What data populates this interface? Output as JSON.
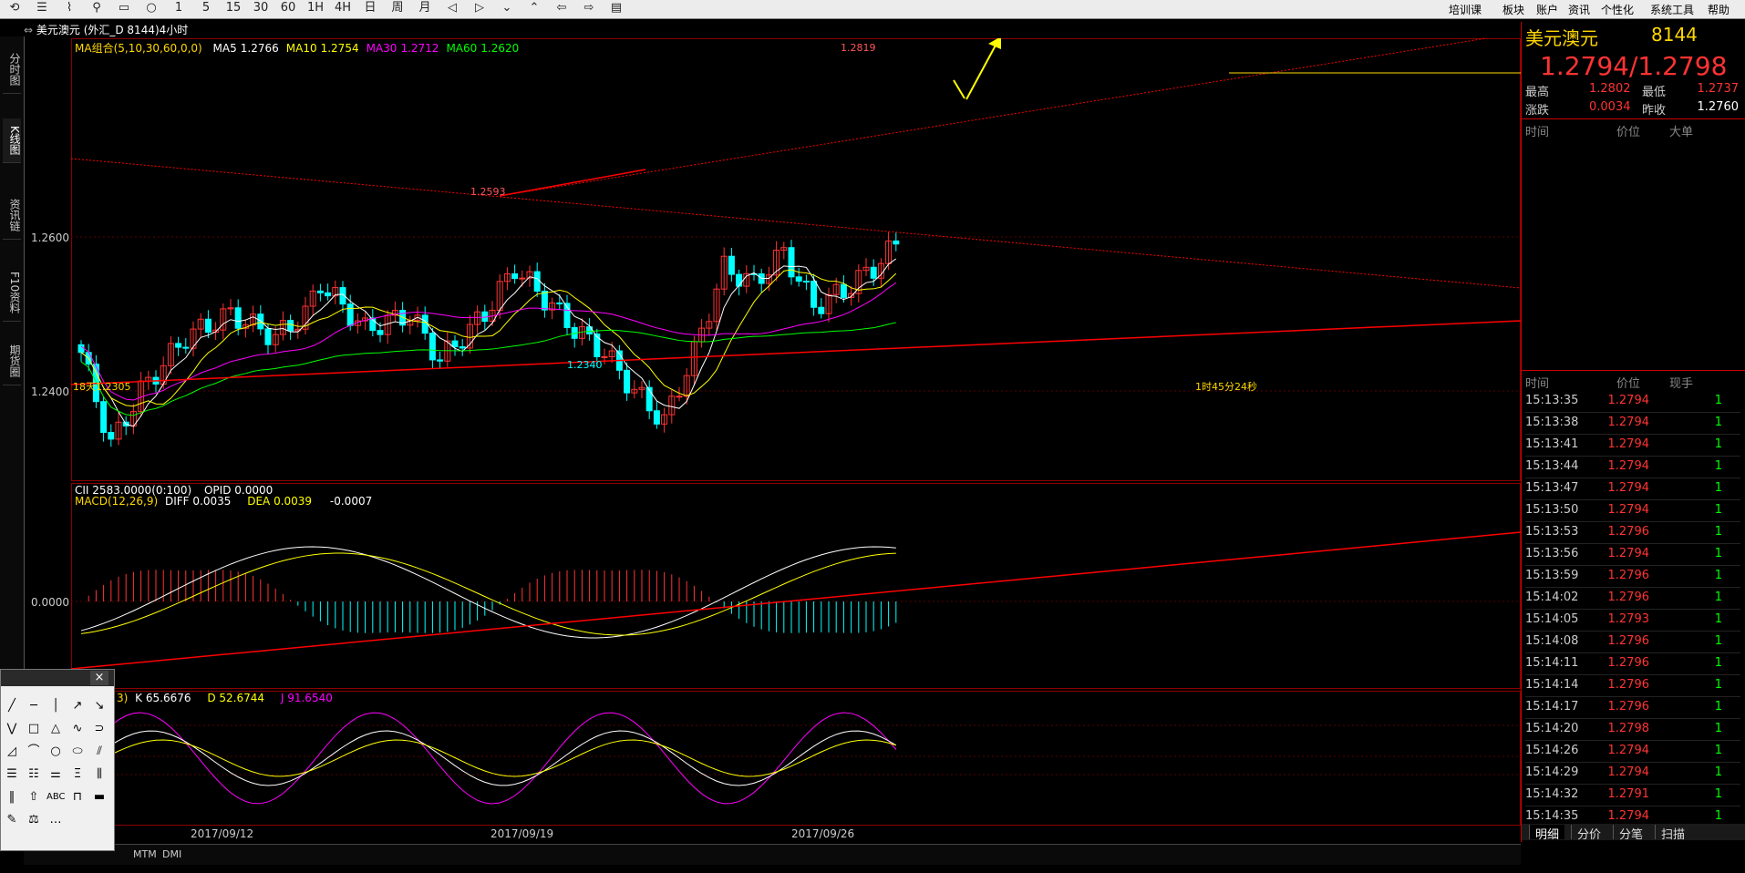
{
  "toolbar": {
    "icons": [
      "back-icon",
      "list-icon",
      "chart-icon",
      "zoom-icon",
      "box-icon",
      "circle-icon",
      "period-icon",
      "period-icon",
      "period-icon",
      "period-icon",
      "period-icon",
      "period-icon",
      "day-icon",
      "week-icon",
      "month-icon",
      "left-icon",
      "right-icon",
      "down-icon",
      "up-icon",
      "prev-icon",
      "next-icon",
      "doc-icon",
      "more-icon"
    ],
    "period_labels": [
      "1",
      "5",
      "15",
      "30",
      "60",
      "1H",
      "4H",
      "日",
      "周",
      "月"
    ],
    "menu": [
      "培训课",
      "板块",
      "账户",
      "资讯",
      "个性化",
      "系统工具",
      "帮助"
    ]
  },
  "title": "美元澳元 (外汇_D 8144)4小时",
  "left_tabs": [
    "分时图",
    "K线图",
    "资讯链",
    "F10资料",
    "期货圈"
  ],
  "main_chart": {
    "ma_legend": {
      "label": "MA组合(5,10,30,60,0,0)",
      "items": [
        {
          "name": "MA5",
          "value": "1.2766",
          "color": "#ffffff"
        },
        {
          "name": "MA10",
          "value": "1.2754",
          "color": "#ffff00"
        },
        {
          "name": "MA30",
          "value": "1.2712",
          "color": "#ff00ff"
        },
        {
          "name": "MA60",
          "value": "1.2620",
          "color": "#00ff00"
        }
      ]
    },
    "y_ticks": [
      "1.2600",
      "1.2400"
    ],
    "annotations": [
      "1.2819",
      "1.2593",
      "1.2340",
      "18天1.2305",
      "1时45分24秒"
    ]
  },
  "macd": {
    "cii_label": "CII",
    "cii_value": "2583.0000(0:100)",
    "opid_label": "OPID",
    "opid_value": "0.0000",
    "label": "MACD(12,26,9)",
    "diff_label": "DIFF",
    "diff_value": "0.0035",
    "dea_label": "DEA",
    "dea_value": "0.0039",
    "macd_value": "-0.0007",
    "y_tick": "0.0000"
  },
  "kdj": {
    "label_partial": "3)",
    "k_label": "K",
    "k_value": "65.6676",
    "d_label": "D",
    "d_value": "52.6744",
    "j_label": "J",
    "j_value": "91.6540"
  },
  "x_axis": [
    "2017/09/12",
    "2017/09/19",
    "2017/09/26"
  ],
  "bottom_tabs": [
    "MTM",
    "DMI"
  ],
  "quote": {
    "name": "美元澳元",
    "code": "8144",
    "bid_ask": "1.2794/1.2798",
    "high_label": "最高",
    "high": "1.2802",
    "low_label": "最低",
    "low": "1.2737",
    "change_label": "涨跌",
    "change": "0.0034",
    "prev_label": "昨收",
    "prev": "1.2760",
    "big_orders_headers": [
      "时间",
      "价位",
      "大单"
    ],
    "ticks_headers": [
      "时间",
      "价位",
      "现手"
    ],
    "ticks": [
      {
        "time": "15:13:35",
        "price": "1.2794",
        "vol": "1"
      },
      {
        "time": "15:13:38",
        "price": "1.2794",
        "vol": "1"
      },
      {
        "time": "15:13:41",
        "price": "1.2794",
        "vol": "1"
      },
      {
        "time": "15:13:44",
        "price": "1.2794",
        "vol": "1"
      },
      {
        "time": "15:13:47",
        "price": "1.2794",
        "vol": "1"
      },
      {
        "time": "15:13:50",
        "price": "1.2794",
        "vol": "1"
      },
      {
        "time": "15:13:53",
        "price": "1.2796",
        "vol": "1"
      },
      {
        "time": "15:13:56",
        "price": "1.2794",
        "vol": "1"
      },
      {
        "time": "15:13:59",
        "price": "1.2796",
        "vol": "1"
      },
      {
        "time": "15:14:02",
        "price": "1.2796",
        "vol": "1"
      },
      {
        "time": "15:14:05",
        "price": "1.2793",
        "vol": "1"
      },
      {
        "time": "15:14:08",
        "price": "1.2796",
        "vol": "1"
      },
      {
        "time": "15:14:11",
        "price": "1.2796",
        "vol": "1"
      },
      {
        "time": "15:14:14",
        "price": "1.2796",
        "vol": "1"
      },
      {
        "time": "15:14:17",
        "price": "1.2796",
        "vol": "1"
      },
      {
        "time": "15:14:20",
        "price": "1.2798",
        "vol": "1"
      },
      {
        "time": "15:14:26",
        "price": "1.2794",
        "vol": "1"
      },
      {
        "time": "15:14:29",
        "price": "1.2794",
        "vol": "1"
      },
      {
        "time": "15:14:32",
        "price": "1.2791",
        "vol": "1"
      },
      {
        "time": "15:14:35",
        "price": "1.2794",
        "vol": "1"
      }
    ],
    "tabs": [
      "明细",
      "分价",
      "分笔",
      "扫描"
    ]
  },
  "palette": {
    "close": "×",
    "items": [
      "╱",
      "─",
      "│",
      "↗",
      "↘",
      "⋁",
      "□",
      "△",
      "∿",
      "⊃",
      "◿",
      "⌒",
      "○",
      "⬭",
      "⫽",
      "☰",
      "☷",
      "⚌",
      "Ξ",
      "⫼",
      "‖",
      "⇧",
      "ABC",
      "⊓",
      "▬",
      "✎",
      "⚖",
      "…"
    ]
  },
  "colors": {
    "up": "#ff3333",
    "down": "#00ffff",
    "ma5": "#ffffff",
    "ma10": "#ffff00",
    "ma30": "#ff00ff",
    "ma60": "#00ff00",
    "trend": "#ff0000",
    "arrow": "#ffff00"
  }
}
